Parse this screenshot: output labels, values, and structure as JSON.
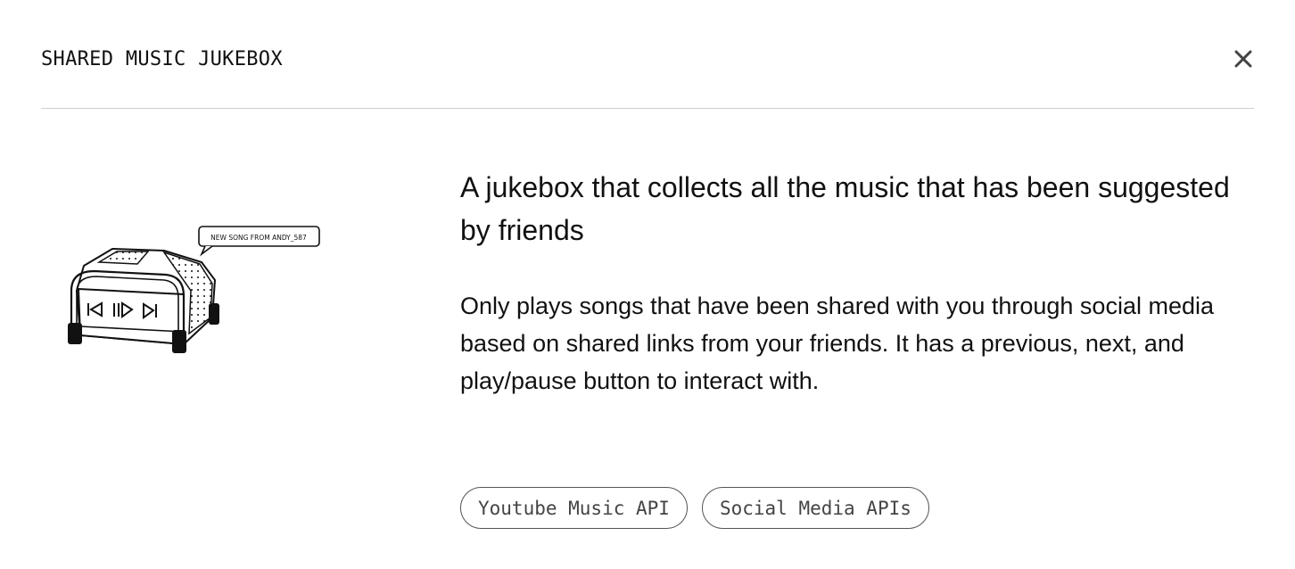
{
  "modal": {
    "title": "SHARED MUSIC JUKEBOX",
    "close_icon": "close-icon"
  },
  "illustration": {
    "speech_bubble_text": "NEW SONG FROM ANDY_587"
  },
  "content": {
    "headline": "A jukebox that collects all the music that has been suggested by friends",
    "description": "Only plays songs that have been shared with you through social media based on shared links from your friends. It has a previous, next, and play/pause button to interact with."
  },
  "tags": [
    {
      "label": "Youtube Music API"
    },
    {
      "label": "Social Media APIs"
    }
  ],
  "colors": {
    "divider": "#cfcfcf",
    "tag_border": "#555555",
    "text": "#111111"
  }
}
